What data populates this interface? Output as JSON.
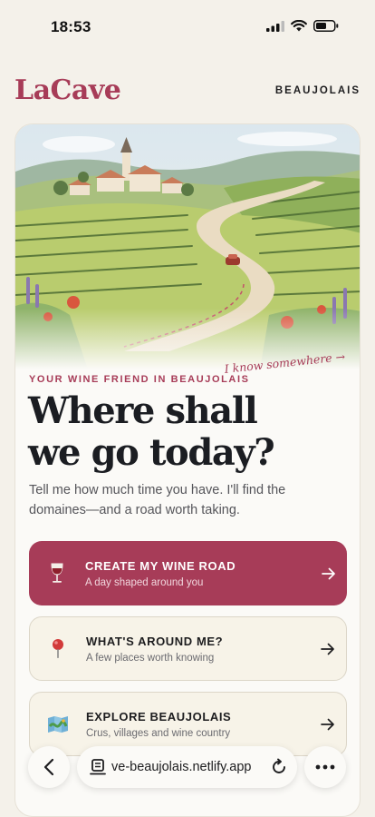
{
  "status_bar": {
    "time": "18:53"
  },
  "header": {
    "logo": "LaCave",
    "region": "BEAUJOLAIS"
  },
  "hero": {
    "caption": "I know somewhere →"
  },
  "intro": {
    "eyebrow": "YOUR WINE FRIEND IN BEAUJOLAIS",
    "headline_line1": "Where shall",
    "headline_line2": "we go today?",
    "subtext": "Tell me how much time you have. I'll find the domaines—and a road worth taking."
  },
  "actions": [
    {
      "title": "CREATE MY WINE ROAD",
      "desc": "A day shaped around you",
      "icon": "wine-glass-icon"
    },
    {
      "title": "WHAT'S AROUND ME?",
      "desc": "A few places worth knowing",
      "icon": "map-pin-icon"
    },
    {
      "title": "EXPLORE BEAUJOLAIS",
      "desc": "Crus, villages and wine country",
      "icon": "map-icon"
    }
  ],
  "browser": {
    "url": "ve-beaujolais.netlify.app"
  },
  "colors": {
    "accent": "#a73c58",
    "background": "#f4f1ea",
    "card": "#fbfaf7"
  }
}
